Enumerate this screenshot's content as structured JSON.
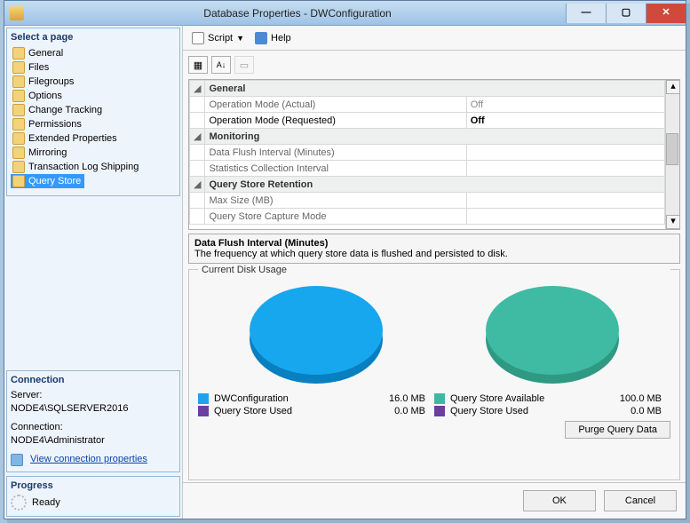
{
  "window_title": "Database Properties - DWConfiguration",
  "left": {
    "select_page_title": "Select a page",
    "pages": [
      "General",
      "Files",
      "Filegroups",
      "Options",
      "Change Tracking",
      "Permissions",
      "Extended Properties",
      "Mirroring",
      "Transaction Log Shipping",
      "Query Store"
    ],
    "selected_index": 9,
    "connection_title": "Connection",
    "server_label": "Server:",
    "server_value": "NODE4\\SQLSERVER2016",
    "conn_label": "Connection:",
    "conn_value": "NODE4\\Administrator",
    "view_props_link": "View connection properties",
    "progress_title": "Progress",
    "progress_state": "Ready"
  },
  "toolbar": {
    "script_label": "Script",
    "help_label": "Help"
  },
  "props": {
    "cat1": "General",
    "row1_key": "Operation Mode (Actual)",
    "row1_val": "Off",
    "row2_key": "Operation Mode (Requested)",
    "row2_val": "Off",
    "cat2": "Monitoring",
    "row3_key": "Data Flush Interval (Minutes)",
    "row3_val": "",
    "row4_key": "Statistics Collection Interval",
    "row4_val": "",
    "cat3": "Query Store Retention",
    "row5_key": "Max Size (MB)",
    "row5_val": "",
    "row6_key": "Query Store Capture Mode",
    "row6_val": ""
  },
  "desc": {
    "title": "Data Flush Interval (Minutes)",
    "text": "The frequency at which query store data is flushed and persisted to disk."
  },
  "chart": {
    "group_label": "Current Disk Usage",
    "left_legend": [
      {
        "name": "DWConfiguration",
        "value": "16.0 MB",
        "color": "#1ea3f0"
      },
      {
        "name": "Query Store Used",
        "value": "0.0 MB",
        "color": "#6b3fa0"
      }
    ],
    "right_legend": [
      {
        "name": "Query Store Available",
        "value": "100.0 MB",
        "color": "#3eb9a1"
      },
      {
        "name": "Query Store Used",
        "value": "0.0 MB",
        "color": "#6b3fa0"
      }
    ],
    "purge_label": "Purge Query Data"
  },
  "dialog": {
    "ok": "OK",
    "cancel": "Cancel"
  },
  "colors": {
    "blue_pie_top": "#17a7ef",
    "blue_pie_side": "#0a7fc0",
    "teal_pie_top": "#3fbba3",
    "teal_pie_side": "#2f9983"
  },
  "chart_data": [
    {
      "type": "pie",
      "title": "Database disk usage",
      "series": [
        {
          "name": "DWConfiguration",
          "value_mb": 16.0
        },
        {
          "name": "Query Store Used",
          "value_mb": 0.0
        }
      ]
    },
    {
      "type": "pie",
      "title": "Query Store disk usage",
      "series": [
        {
          "name": "Query Store Available",
          "value_mb": 100.0
        },
        {
          "name": "Query Store Used",
          "value_mb": 0.0
        }
      ]
    }
  ]
}
